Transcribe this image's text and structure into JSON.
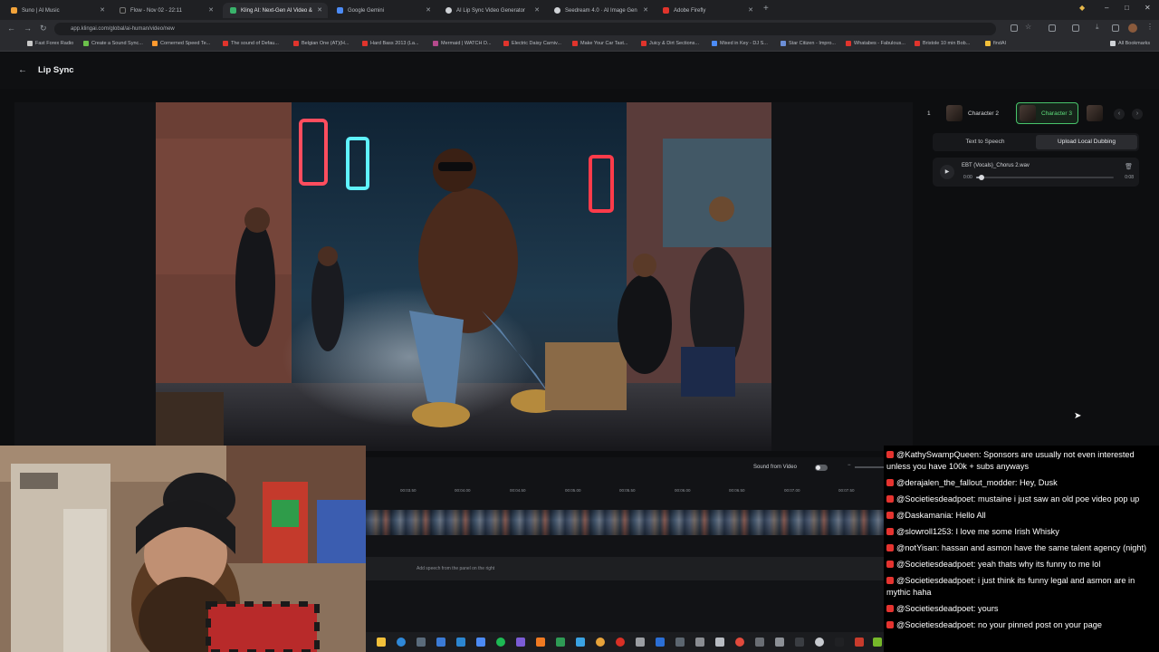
{
  "browser": {
    "tabs": [
      {
        "title": "Suno | AI Music",
        "color": "#f2a33a",
        "active": false
      },
      {
        "title": "Flow - Nov 02 - 22:11",
        "color": "#1f1f1f",
        "active": false
      },
      {
        "title": "Kling AI: Next-Gen AI Video &",
        "color": "#39b36b",
        "active": true
      },
      {
        "title": "Google Gemini",
        "color": "#4c8bf5",
        "active": false
      },
      {
        "title": "AI Lip Sync Video Generator",
        "color": "#cfd2d6",
        "active": false
      },
      {
        "title": "Seedream 4.0 · AI Image Gen",
        "color": "#cfd2d6",
        "active": false
      },
      {
        "title": "Adobe Firefly",
        "color": "#e0342c",
        "active": false
      }
    ],
    "url": "app.klingai.com/global/ai-human/video/new",
    "bookmarks": [
      {
        "label": "Fast Forex Radio",
        "color": "#c9c9c9"
      },
      {
        "label": "Create a Sound Sync...",
        "color": "#6bc04b"
      },
      {
        "label": "Cornerned Speed Te...",
        "color": "#ff9a2f"
      },
      {
        "label": "The sound of Defau...",
        "color": "#e0342c"
      },
      {
        "label": "Belgian One (AT)(H...",
        "color": "#e0342c"
      },
      {
        "label": "Hard Bass 2013 (La...",
        "color": "#e0342c"
      },
      {
        "label": "Mermaid | WATCH D...",
        "color": "#b54a8d"
      },
      {
        "label": "Electric Daisy Carniv...",
        "color": "#e0342c"
      },
      {
        "label": "Make Your Car Tast...",
        "color": "#e0342c"
      },
      {
        "label": "Juicy & Dirt Sections...",
        "color": "#e0342c"
      },
      {
        "label": "Mixed in Key - DJ S...",
        "color": "#4c8bf5"
      },
      {
        "label": "Star Citizen - Impro...",
        "color": "#6b8ed6"
      },
      {
        "label": "Whatabes - Fabulous...",
        "color": "#e0342c"
      },
      {
        "label": "Bristole 10 min Bob...",
        "color": "#e0342c"
      },
      {
        "label": "findAI",
        "color": "#f2c03a"
      },
      {
        "label": "All Bookmarks",
        "color": "#cfd2d6"
      }
    ]
  },
  "app": {
    "title": "Lip Sync"
  },
  "characters": {
    "first_label": "1",
    "items": [
      {
        "label": "Character 2",
        "selected": false
      },
      {
        "label": "Character 3",
        "selected": true
      },
      {
        "label": "",
        "selected": false
      }
    ]
  },
  "modes": {
    "text_to_speech": "Text to Speech",
    "upload_local_dubbing": "Upload Local Dubbing",
    "active": "upload_local_dubbing"
  },
  "audio": {
    "file_name": "EBT (Vocals)_Chorus 2.wav",
    "current_time": "0:00",
    "duration": "0:08",
    "progress": 0.04
  },
  "timeline": {
    "sound_from_video_label": "Sound from Video",
    "ticks": [
      "00:03.50",
      "00:04.00",
      "00:04.50",
      "00:05.00",
      "00:05.50",
      "00:06.00",
      "00:06.50",
      "00:07.00",
      "00:07.50"
    ],
    "speech_hint": "Add speech from the panel on the right"
  },
  "chat": [
    {
      "user": "@KathySwampQueen:",
      "text": "Sponsors are usually not even interested unless you have 100k + subs anyways"
    },
    {
      "user": "@derajalen_the_fallout_modder:",
      "text": "Hey, Dusk"
    },
    {
      "user": "@Societiesdeadpoet:",
      "text": "mustaine i just saw an old poe video pop up"
    },
    {
      "user": "@Daskamania:",
      "text": "Hello All"
    },
    {
      "user": "@slowroll1253:",
      "text": "I love me some Irish Whisky"
    },
    {
      "user": "@notYisan:",
      "text": "hassan and asmon have the same talent agency (night)"
    },
    {
      "user": "@Societiesdeadpoet:",
      "text": "yeah thats why its funny to me lol"
    },
    {
      "user": "@Societiesdeadpoet:",
      "text": "i just think its funny legal and asmon are in mythic haha"
    },
    {
      "user": "@Societiesdeadpoet:",
      "text": "yours"
    },
    {
      "user": "@Societiesdeadpoet:",
      "text": "no your pinned post on your page"
    }
  ],
  "colors": {
    "accent": "#48c46a",
    "chat_badge": "#e5332f"
  }
}
